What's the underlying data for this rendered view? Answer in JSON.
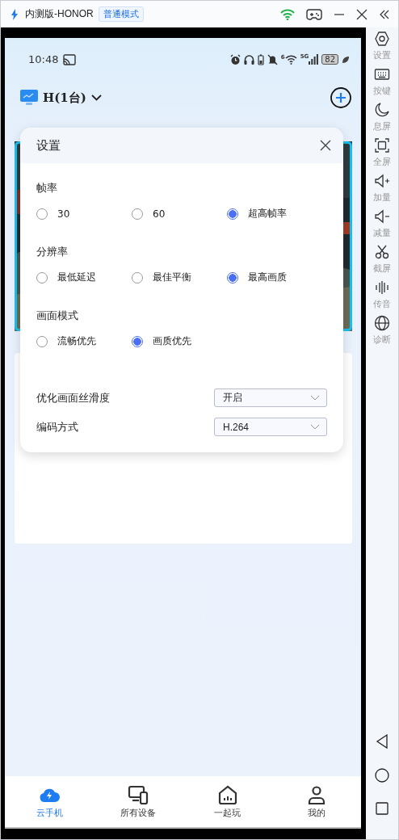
{
  "window": {
    "title": "内测版-HONOR",
    "mode_badge": "普通模式"
  },
  "status_bar": {
    "time": "10:48",
    "wifi_label": "6",
    "network": "5G",
    "battery": "82"
  },
  "header": {
    "group": "H(1台)"
  },
  "dialog": {
    "title": "设置",
    "sections": [
      {
        "label": "帧率",
        "options": [
          {
            "label": "30",
            "selected": false
          },
          {
            "label": "60",
            "selected": false
          },
          {
            "label": "超高帧率",
            "selected": true
          }
        ]
      },
      {
        "label": "分辨率",
        "options": [
          {
            "label": "最低延迟",
            "selected": false
          },
          {
            "label": "最佳平衡",
            "selected": false
          },
          {
            "label": "最高画质",
            "selected": true
          }
        ]
      },
      {
        "label": "画面模式",
        "options": [
          {
            "label": "流畅优先",
            "selected": false
          },
          {
            "label": "画质优先",
            "selected": true
          }
        ]
      }
    ],
    "dropdowns": [
      {
        "label": "优化画面丝滑度",
        "value": "开启"
      },
      {
        "label": "编码方式",
        "value": "H.264"
      }
    ]
  },
  "toolbar": [
    {
      "kind": "settings",
      "label": "设置"
    },
    {
      "kind": "keyboard",
      "label": "按键"
    },
    {
      "kind": "moon",
      "label": "息屏"
    },
    {
      "kind": "fullscreen",
      "label": "全屏"
    },
    {
      "kind": "volup",
      "label": "加量"
    },
    {
      "kind": "voldown",
      "label": "减量"
    },
    {
      "kind": "scissors",
      "label": "截屏"
    },
    {
      "kind": "wave",
      "label": "传音"
    },
    {
      "kind": "globe",
      "label": "诊断"
    }
  ],
  "nav_bar": [
    {
      "kind": "cloud",
      "label": "云手机",
      "selected": true
    },
    {
      "kind": "devices",
      "label": "所有设备",
      "selected": false
    },
    {
      "kind": "home",
      "label": "一起玩",
      "selected": false
    },
    {
      "kind": "person",
      "label": "我的",
      "selected": false
    }
  ]
}
